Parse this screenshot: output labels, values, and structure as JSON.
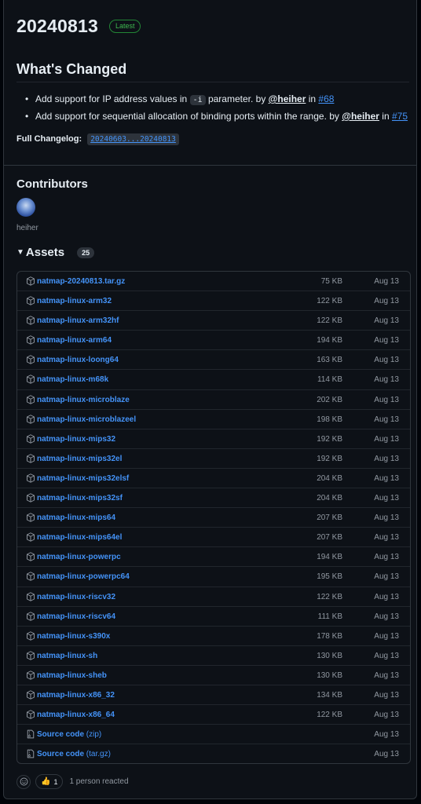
{
  "release": {
    "title": "20240813",
    "badge": "Latest"
  },
  "whats_changed": {
    "heading": "What's Changed",
    "items": [
      {
        "pre": "Add support for IP address values in ",
        "code": "-i",
        "mid": " parameter. by ",
        "mention": "@heiher",
        "in": " in ",
        "issue": "#68"
      },
      {
        "pre": "Add support for sequential allocation of binding ports within the range. by ",
        "mention": "@heiher",
        "in": " in ",
        "issue": "#75"
      }
    ],
    "changelog_label": "Full Changelog",
    "changelog_colon": ":",
    "changelog_link": "20240603...20240813"
  },
  "contributors": {
    "heading": "Contributors",
    "names": [
      "heiher"
    ]
  },
  "assets": {
    "heading": "Assets",
    "count": "25",
    "rows": [
      {
        "name": "natmap-20240813.tar.gz",
        "size": "75 KB",
        "date": "Aug 13",
        "icon": "package-icon"
      },
      {
        "name": "natmap-linux-arm32",
        "size": "122 KB",
        "date": "Aug 13",
        "icon": "package-icon"
      },
      {
        "name": "natmap-linux-arm32hf",
        "size": "122 KB",
        "date": "Aug 13",
        "icon": "package-icon"
      },
      {
        "name": "natmap-linux-arm64",
        "size": "194 KB",
        "date": "Aug 13",
        "icon": "package-icon"
      },
      {
        "name": "natmap-linux-loong64",
        "size": "163 KB",
        "date": "Aug 13",
        "icon": "package-icon"
      },
      {
        "name": "natmap-linux-m68k",
        "size": "114 KB",
        "date": "Aug 13",
        "icon": "package-icon"
      },
      {
        "name": "natmap-linux-microblaze",
        "size": "202 KB",
        "date": "Aug 13",
        "icon": "package-icon"
      },
      {
        "name": "natmap-linux-microblazeel",
        "size": "198 KB",
        "date": "Aug 13",
        "icon": "package-icon"
      },
      {
        "name": "natmap-linux-mips32",
        "size": "192 KB",
        "date": "Aug 13",
        "icon": "package-icon"
      },
      {
        "name": "natmap-linux-mips32el",
        "size": "192 KB",
        "date": "Aug 13",
        "icon": "package-icon"
      },
      {
        "name": "natmap-linux-mips32elsf",
        "size": "204 KB",
        "date": "Aug 13",
        "icon": "package-icon"
      },
      {
        "name": "natmap-linux-mips32sf",
        "size": "204 KB",
        "date": "Aug 13",
        "icon": "package-icon"
      },
      {
        "name": "natmap-linux-mips64",
        "size": "207 KB",
        "date": "Aug 13",
        "icon": "package-icon"
      },
      {
        "name": "natmap-linux-mips64el",
        "size": "207 KB",
        "date": "Aug 13",
        "icon": "package-icon"
      },
      {
        "name": "natmap-linux-powerpc",
        "size": "194 KB",
        "date": "Aug 13",
        "icon": "package-icon"
      },
      {
        "name": "natmap-linux-powerpc64",
        "size": "195 KB",
        "date": "Aug 13",
        "icon": "package-icon"
      },
      {
        "name": "natmap-linux-riscv32",
        "size": "122 KB",
        "date": "Aug 13",
        "icon": "package-icon"
      },
      {
        "name": "natmap-linux-riscv64",
        "size": "111 KB",
        "date": "Aug 13",
        "icon": "package-icon"
      },
      {
        "name": "natmap-linux-s390x",
        "size": "178 KB",
        "date": "Aug 13",
        "icon": "package-icon"
      },
      {
        "name": "natmap-linux-sh",
        "size": "130 KB",
        "date": "Aug 13",
        "icon": "package-icon"
      },
      {
        "name": "natmap-linux-sheb",
        "size": "130 KB",
        "date": "Aug 13",
        "icon": "package-icon"
      },
      {
        "name": "natmap-linux-x86_32",
        "size": "134 KB",
        "date": "Aug 13",
        "icon": "package-icon"
      },
      {
        "name": "natmap-linux-x86_64",
        "size": "122 KB",
        "date": "Aug 13",
        "icon": "package-icon"
      },
      {
        "name": "Source code",
        "suffix": " (zip)",
        "size": "",
        "date": "Aug 13",
        "icon": "file-zip-icon"
      },
      {
        "name": "Source code",
        "suffix": " (tar.gz)",
        "size": "",
        "date": "Aug 13",
        "icon": "file-zip-icon"
      }
    ]
  },
  "reactions": {
    "thumbs_up_emoji": "👍",
    "thumbs_up_count": "1",
    "summary": "1 person reacted"
  },
  "colors": {
    "background": "#0d1117",
    "link": "#4493f8",
    "latest_badge": "#3fb950",
    "muted": "#9198a1"
  }
}
